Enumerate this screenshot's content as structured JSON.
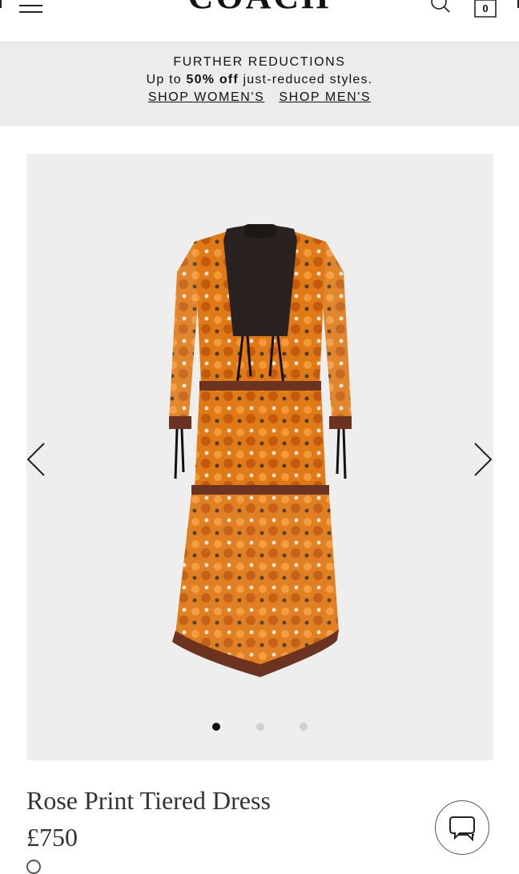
{
  "header": {
    "logo": "COACH",
    "bag_count": "0",
    "menu_icon": "hamburger-icon",
    "search_icon": "search-icon",
    "bag_icon": "shopping-bag-icon"
  },
  "promo": {
    "title": "FURTHER REDUCTIONS",
    "sub_prefix": "Up to ",
    "sub_bold": "50% off",
    "sub_suffix": " just-reduced styles.",
    "link_women": "SHOP WOMEN'S",
    "link_men": "SHOP MEN'S"
  },
  "gallery": {
    "prev_icon": "chevron-left-icon",
    "next_icon": "chevron-right-icon",
    "image_count": 3,
    "active_index": 0,
    "colors": {
      "dress_orange": "#e07a17",
      "dress_dark": "#2a2220",
      "trim": "#6b3320"
    }
  },
  "product": {
    "name": "Rose Print Tiered Dress",
    "price": "£750",
    "chat_icon": "chat-bubbles-icon"
  }
}
